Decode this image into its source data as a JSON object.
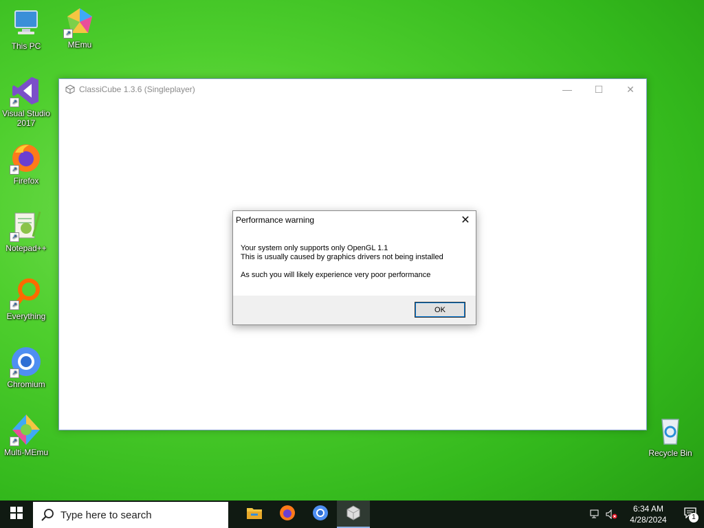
{
  "desktop": {
    "icons": [
      {
        "label": "This PC",
        "icon": "computer-icon"
      },
      {
        "label": "MEmu",
        "icon": "memu-icon"
      },
      {
        "label": "Visual Studio 2017",
        "icon": "visual-studio-icon"
      },
      {
        "label": "Firefox",
        "icon": "firefox-icon"
      },
      {
        "label": "Notepad++",
        "icon": "notepadpp-icon"
      },
      {
        "label": "Everything",
        "icon": "everything-icon"
      },
      {
        "label": "Chromium",
        "icon": "chromium-icon"
      },
      {
        "label": "Multi-MEmu",
        "icon": "multi-memu-icon"
      },
      {
        "label": "Recycle Bin",
        "icon": "recycle-bin-icon"
      }
    ]
  },
  "app_window": {
    "title": "ClassiCube 1.3.6 (Singleplayer)",
    "minimize": "—",
    "maximize": "☐",
    "close": "✕"
  },
  "dialog": {
    "title": "Performance warning",
    "close": "✕",
    "line1": "Your system only supports only OpenGL 1.1",
    "line2": "This is usually caused by graphics drivers not being installed",
    "line3": "As such you will likely experience very poor performance",
    "ok_label": "OK"
  },
  "taskbar": {
    "search_placeholder": "Type here to search",
    "apps": [
      "file-explorer-icon",
      "firefox-icon",
      "chromium-icon",
      "classicube-icon"
    ],
    "time": "6:34 AM",
    "date": "4/28/2024",
    "notification_count": "1"
  },
  "colors": {
    "taskbar_bg": "#101a12",
    "accent": "#0078d7"
  }
}
